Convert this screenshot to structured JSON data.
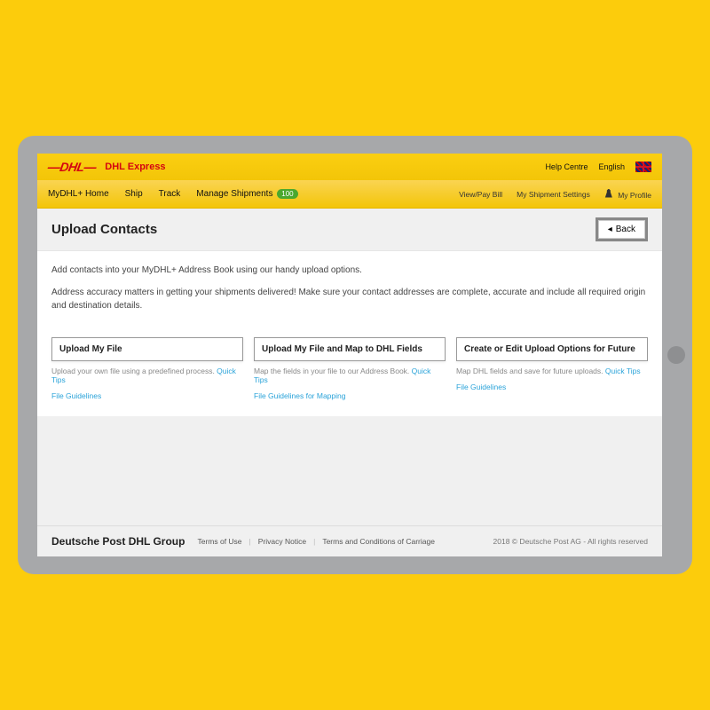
{
  "topbar": {
    "brand_name": "DHL Express",
    "help_centre": "Help Centre",
    "language": "English"
  },
  "nav": {
    "home": "MyDHL+ Home",
    "ship": "Ship",
    "track": "Track",
    "manage": "Manage Shipments",
    "manage_badge": "100",
    "view_pay": "View/Pay Bill",
    "shipment_settings": "My Shipment Settings",
    "my_profile": "My Profile"
  },
  "page": {
    "title": "Upload Contacts",
    "back": "Back"
  },
  "body": {
    "intro": "Add contacts into your MyDHL+ Address Book using our handy upload options.",
    "accuracy_note": "Address accuracy matters in getting your shipments delivered! Make sure your contact addresses are complete, accurate and include all required origin and destination details."
  },
  "options": [
    {
      "button": "Upload My File",
      "desc_prefix": "Upload your own file using a predefined process. ",
      "tips": "Quick Tips",
      "guidelines": "File Guidelines"
    },
    {
      "button": "Upload My File and Map to DHL Fields",
      "desc_prefix": "Map the fields in your file to our Address Book. ",
      "tips": "Quick Tips",
      "guidelines": "File Guidelines for Mapping"
    },
    {
      "button": "Create or Edit Upload Options for Future",
      "desc_prefix": "Map DHL fields and save for future uploads. ",
      "tips": "Quick Tips",
      "guidelines": "File Guidelines"
    }
  ],
  "footer": {
    "brand": "Deutsche Post DHL Group",
    "terms": "Terms of Use",
    "privacy": "Privacy Notice",
    "carriage": "Terms and Conditions of Carriage",
    "copyright": "2018 © Deutsche Post AG - All rights reserved"
  }
}
